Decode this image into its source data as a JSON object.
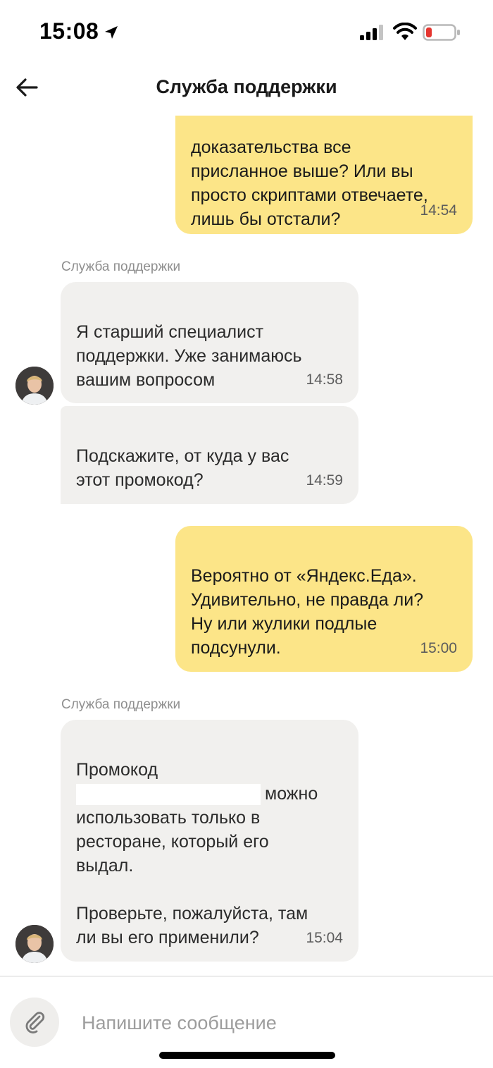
{
  "status_bar": {
    "time": "15:08",
    "icons": [
      "location-arrow-icon",
      "cellular-signal-icon",
      "wifi-icon",
      "battery-low-icon"
    ],
    "battery_color": "#e5352f"
  },
  "header": {
    "title": "Служба поддержки",
    "back_icon": "arrow-left-icon"
  },
  "colors": {
    "outgoing_bubble": "#fce588",
    "incoming_bubble": "#f1f0ee"
  },
  "messages": [
    {
      "direction": "out",
      "text": "доказательства все\nприсланное выше? Или вы\nпросто скриптами отвечаете,\nлишь бы отстали?",
      "time": "14:54"
    },
    {
      "direction": "in",
      "sender": "Служба поддержки",
      "text": "Я старший специалист\nподдержки. Уже занимаюсь\nвашим вопросом",
      "time": "14:58"
    },
    {
      "direction": "in",
      "text": "Подскажите, от куда у вас\nэтот промокод?",
      "time": "14:59"
    },
    {
      "direction": "out",
      "text": "Вероятно от «Яндекс.Еда».\nУдивительно, не правда ли?\nНу или жулики подлые\nподсунули.",
      "time": "15:00"
    },
    {
      "direction": "in",
      "sender": "Служба поддержки",
      "text_line1": "Промокод",
      "text_after_redaction": "можно",
      "text_rest": "использовать только в\nресторане, который его\nвыдал.\n\nПроверьте, пожалуйста, там\nли вы его применили?",
      "time": "15:04"
    }
  ],
  "composer": {
    "placeholder": "Напишите сообщение",
    "attach_icon": "paperclip-icon"
  }
}
